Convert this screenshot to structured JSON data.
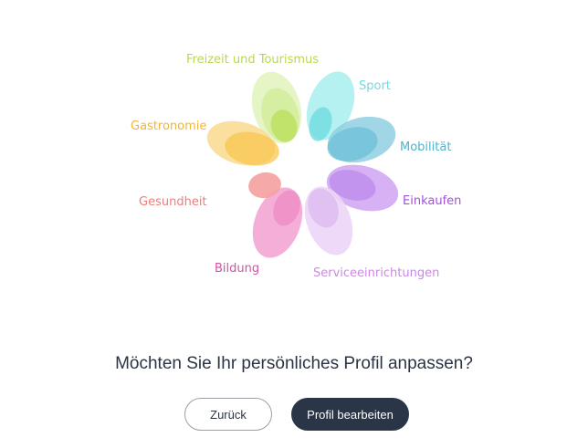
{
  "categories": [
    {
      "key": "freizeit",
      "label": "Freizeit und Tourismus",
      "color": "#b9da4a"
    },
    {
      "key": "sport",
      "label": "Sport",
      "color": "#6fdce0"
    },
    {
      "key": "mobilitaet",
      "label": "Mobilität",
      "color": "#4fb3cc"
    },
    {
      "key": "einkaufen",
      "label": "Einkaufen",
      "color": "#a052d9"
    },
    {
      "key": "service",
      "label": "Serviceeinrichtungen",
      "color": "#c98ae0"
    },
    {
      "key": "bildung",
      "label": "Bildung",
      "color": "#d94fa8"
    },
    {
      "key": "gesundheit",
      "label": "Gesundheit",
      "color": "#f07c7c"
    },
    {
      "key": "gastronomie",
      "label": "Gastronomie",
      "color": "#f5b52e"
    }
  ],
  "prompt": {
    "question": "Möchten Sie Ihr persönliches Profil anpassen?"
  },
  "actions": {
    "back_label": "Zurück",
    "edit_label": "Profil bearbeiten"
  }
}
